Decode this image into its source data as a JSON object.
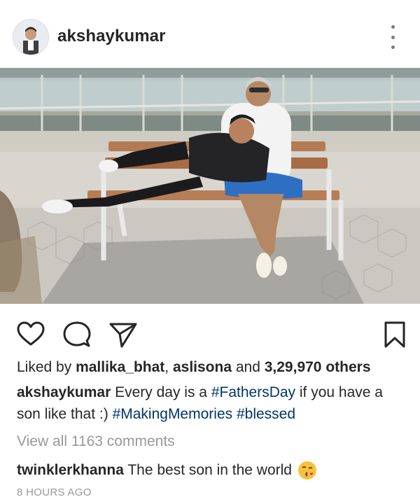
{
  "post": {
    "username": "akshaykumar",
    "avatar_icon": "profile-photo",
    "more_icon": "more-vertical-icon"
  },
  "actions": {
    "like_icon": "heart-outline-icon",
    "comment_icon": "comment-bubble-icon",
    "share_icon": "paper-plane-icon",
    "save_icon": "bookmark-outline-icon"
  },
  "likes": {
    "prefix": "Liked by ",
    "user1": "mallika_bhat",
    "separator": ", ",
    "user2": "aslisona",
    "connector": " and ",
    "count": "3,29,970 others"
  },
  "caption": {
    "username": "akshaykumar",
    "text1": " Every day is a ",
    "tag1": "#FathersDay",
    "text2": " if you have a son like that :) ",
    "tag2": "#MakingMemories",
    "text3": " ",
    "tag3": "#blessed"
  },
  "comments": {
    "view_all": "View all 1163 comments",
    "top_comment": {
      "username": "twinklerkhanna",
      "text": " The best son in the world",
      "emoji": "kissing-face-emoji"
    }
  },
  "timestamp": "8 HOURS AGO",
  "colors": {
    "text": "#262626",
    "muted": "#999999",
    "hashtag": "#003569"
  }
}
